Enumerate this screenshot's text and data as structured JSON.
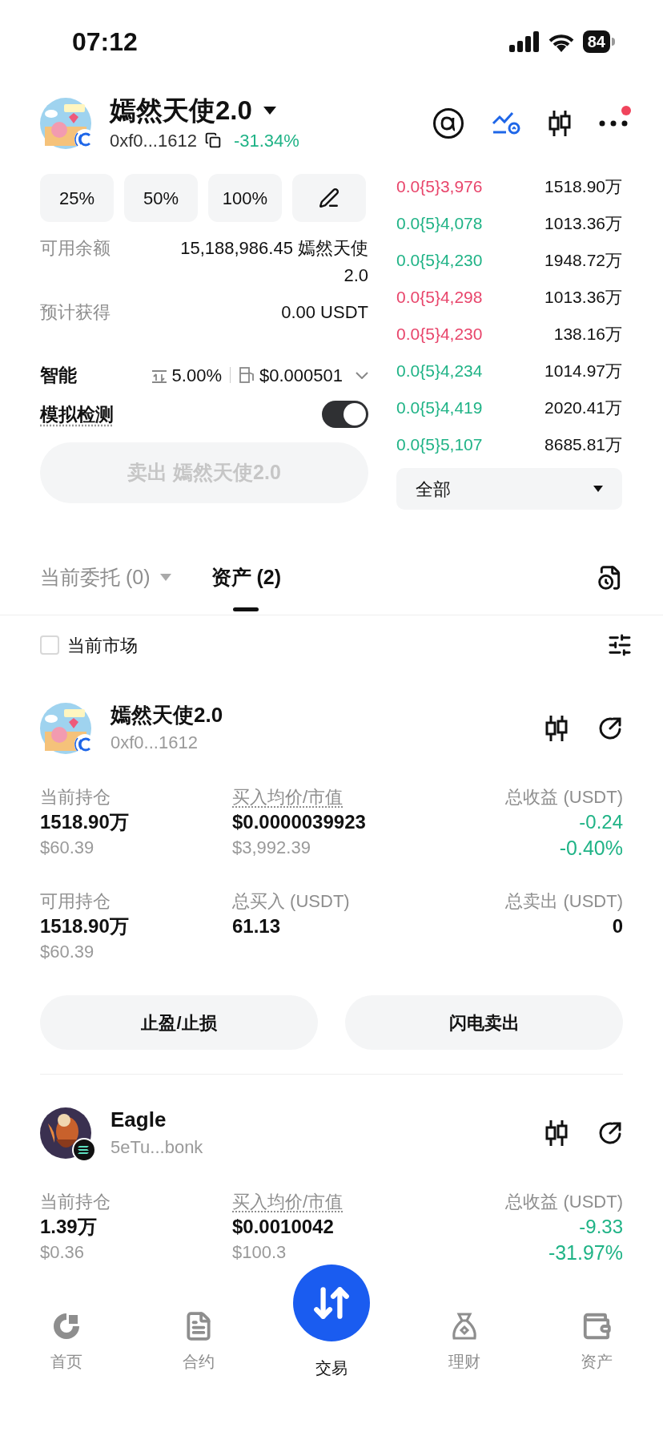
{
  "status_bar": {
    "time": "07:12",
    "battery": "84"
  },
  "token": {
    "name": "嫣然天使2.0",
    "address": "0xf0...1612",
    "change": "-31.34%"
  },
  "header_alert": true,
  "quick_amounts": [
    "25%",
    "50%",
    "100%"
  ],
  "balance": {
    "label": "可用余额",
    "value": "15,188,986.45 嫣然天使2.0"
  },
  "expected": {
    "label": "预计获得",
    "value": "0.00 USDT"
  },
  "smart": {
    "label": "智能",
    "slippage": "5.00%",
    "gas": "$0.000501"
  },
  "simulation": {
    "label": "模拟检测",
    "on": true
  },
  "sell_button": {
    "label": "卖出 嫣然天使2.0",
    "disabled": true
  },
  "order_book": [
    {
      "price": "0.0{5}3,976",
      "amount": "1518.90万",
      "color": "#e8456b"
    },
    {
      "price": "0.0{5}4,078",
      "amount": "1013.36万",
      "color": "#1fb386"
    },
    {
      "price": "0.0{5}4,230",
      "amount": "1948.72万",
      "color": "#1fb386"
    },
    {
      "price": "0.0{5}4,298",
      "amount": "1013.36万",
      "color": "#e8456b"
    },
    {
      "price": "0.0{5}4,230",
      "amount": "138.16万",
      "color": "#e8456b"
    },
    {
      "price": "0.0{5}4,234",
      "amount": "1014.97万",
      "color": "#1fb386"
    },
    {
      "price": "0.0{5}4,419",
      "amount": "2020.41万",
      "color": "#1fb386"
    },
    {
      "price": "0.0{5}5,107",
      "amount": "8685.81万",
      "color": "#1fb386"
    }
  ],
  "depth_filter": "全部",
  "tabs": [
    {
      "label": "当前委托 (0)",
      "selected": false,
      "kind": "dropdown"
    },
    {
      "label": "资产 (2)",
      "selected": true,
      "kind": "plain"
    }
  ],
  "current_market": {
    "label": "当前市场",
    "checked": false
  },
  "assets": [
    {
      "name": "嫣然天使2.0",
      "address": "0xf0...1612",
      "kind": "ring",
      "stat_rows": [
        [
          {
            "label": "当前持仓",
            "value": "1518.90万",
            "sub": "$60.39",
            "kind": "amount"
          },
          {
            "label": "买入均价/市值",
            "value": "$0.0000039923",
            "sub": "$3,992.39",
            "kind": "price"
          },
          {
            "label": "总收益 (USDT)",
            "value": "-0.24",
            "sub": "-0.40%",
            "kind": "profit"
          }
        ],
        [
          {
            "label": "可用持仓",
            "value": "1518.90万",
            "sub": "$60.39",
            "kind": "amount"
          },
          {
            "label": "总买入 (USDT)",
            "value": "61.13",
            "kind": "amount"
          },
          {
            "label": "总卖出 (USDT)",
            "value": "0",
            "kind": "amount"
          }
        ]
      ],
      "buttons": [
        "止盈/止损",
        "闪电卖出"
      ]
    },
    {
      "name": "Eagle",
      "address": "5eTu...bonk",
      "kind": "sol",
      "stat_rows": [
        [
          {
            "label": "当前持仓",
            "value": "1.39万",
            "sub": "$0.36",
            "kind": "amount"
          },
          {
            "label": "买入均价/市值",
            "value": "$0.0010042",
            "sub": "$100.3",
            "kind": "price"
          },
          {
            "label": "总收益 (USDT)",
            "value": "-9.33",
            "sub": "-31.97%",
            "kind": "profit"
          }
        ]
      ]
    }
  ],
  "nav": [
    {
      "label": "首页",
      "selected": false,
      "kind": "home"
    },
    {
      "label": "合约",
      "selected": false,
      "kind": "contract"
    },
    {
      "label": "交易",
      "selected": true,
      "kind": "trade"
    },
    {
      "label": "理财",
      "selected": false,
      "kind": "finance"
    },
    {
      "label": "资产",
      "selected": false,
      "kind": "assets"
    }
  ]
}
